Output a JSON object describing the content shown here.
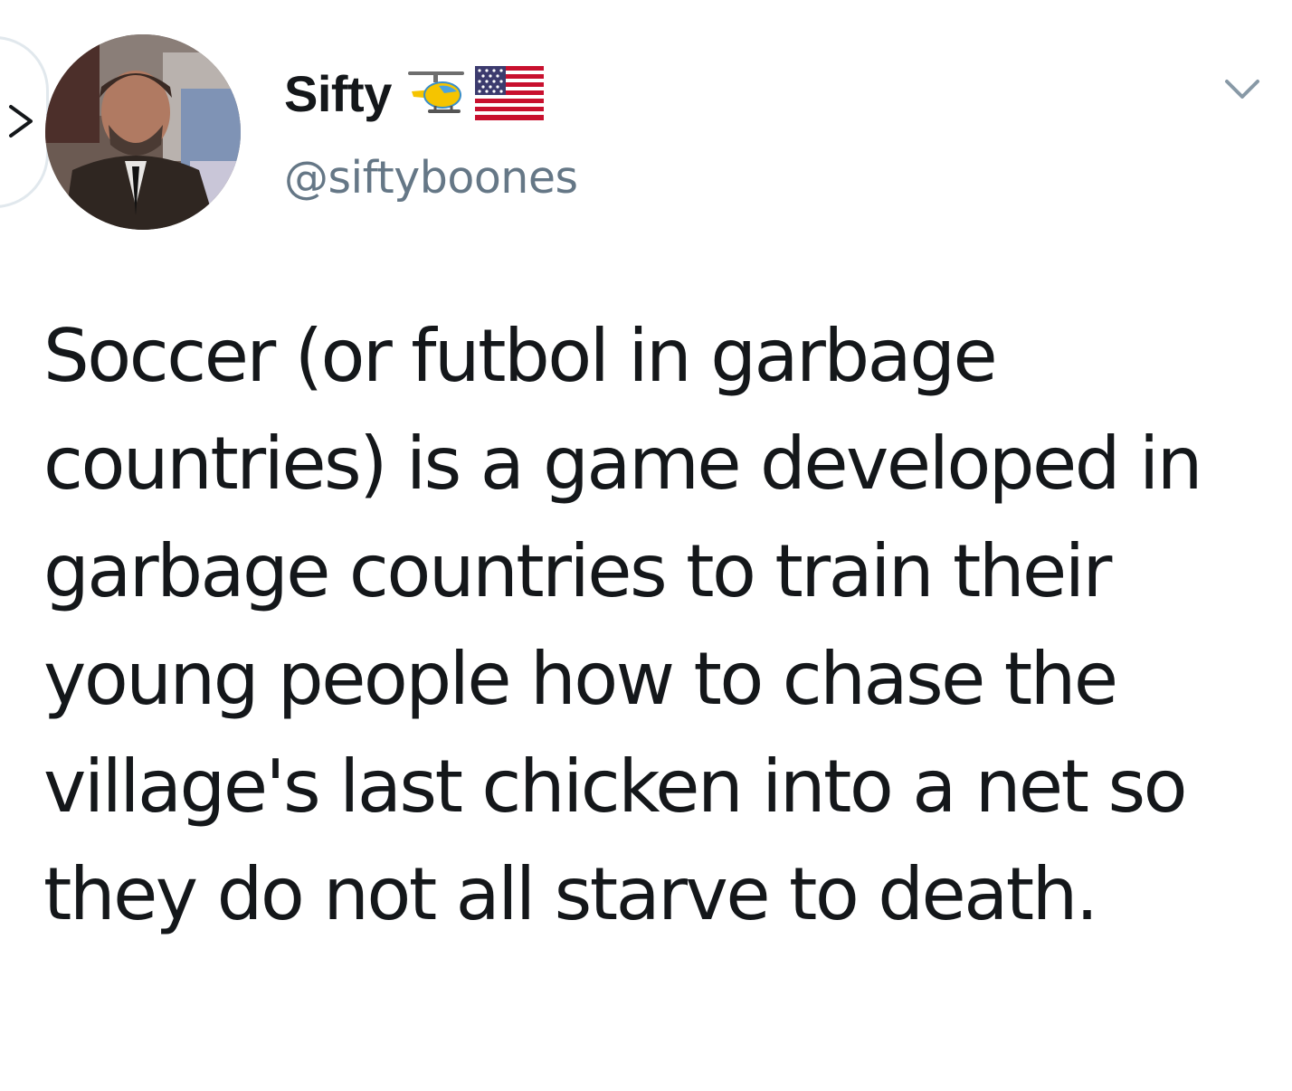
{
  "tweet": {
    "author": {
      "display_name": "Sifty",
      "handle": "@siftyboones",
      "name_emojis": [
        "helicopter-emoji",
        "us-flag-emoji"
      ],
      "avatar": "profile-photo"
    },
    "text": "Soccer (or futbol in garbage countries) is a game developed in garbage countries to train their young people how to chase the village's last chicken into a net so they do not all starve to death.",
    "menu_icon": "chevron-down-icon",
    "thread_icon": "chevron-right-icon"
  },
  "colors": {
    "text_primary": "#14171a",
    "text_secondary": "#657786",
    "border": "#e1e8ed",
    "background": "#ffffff"
  }
}
